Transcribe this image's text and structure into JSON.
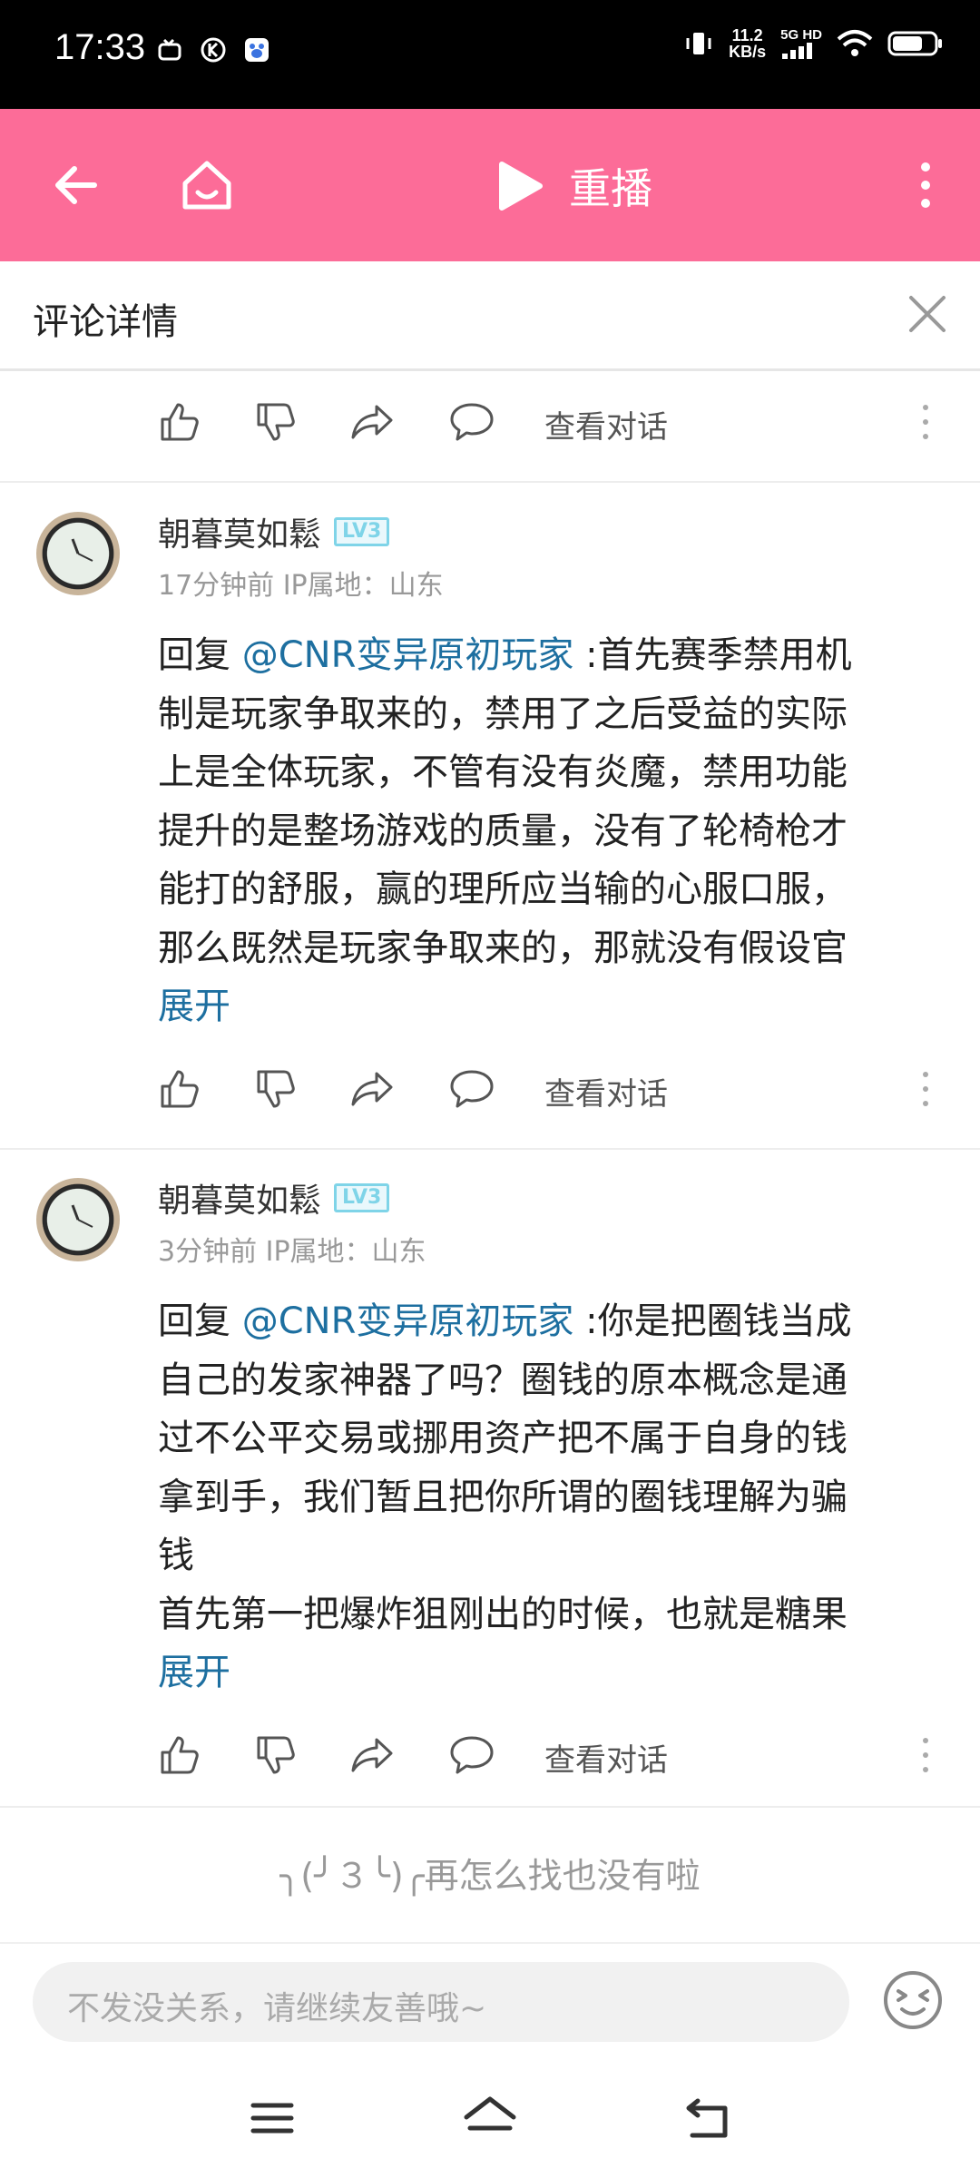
{
  "status_bar": {
    "time": "17:33",
    "speed_value": "11.2",
    "speed_unit": "KB/s",
    "network": "5G HD"
  },
  "app_bar": {
    "replay_label": "重播"
  },
  "detail": {
    "title": "评论详情"
  },
  "action_labels": {
    "view_conversation": "查看对话"
  },
  "comments": [
    {
      "username": "朝暮莫如鬆",
      "level": "LV3",
      "meta": "17分钟前 IP属地：山东",
      "reply_prefix": "回复 ",
      "mention": "@CNR变异原初玩家",
      "text_lines": [
        " :首先赛季禁用机",
        "制是玩家争取来的，禁用了之后受益的实际",
        "上是全体玩家，不管有没有炎魔，禁用功能",
        "提升的是整场游戏的质量，没有了轮椅枪才",
        "能打的舒服，赢的理所应当输的心服口服，",
        "那么既然是玩家争取来的，那就没有假设官"
      ],
      "expand": "展开"
    },
    {
      "username": "朝暮莫如鬆",
      "level": "LV3",
      "meta": "3分钟前 IP属地：山东",
      "reply_prefix": "回复 ",
      "mention": "@CNR变异原初玩家",
      "text_lines": [
        " :你是把圈钱当成",
        "自己的发家神器了吗？圈钱的原本概念是通",
        "过不公平交易或挪用资产把不属于自身的钱",
        "拿到手，我们暂且把你所谓的圈钱理解为骗",
        "钱",
        "首先第一把爆炸狙刚出的时候，也就是糖果"
      ],
      "expand": "展开"
    }
  ],
  "end_tip": "╮(╯３╰)╭再怎么找也没有啦",
  "comment_input": {
    "placeholder": "不发没关系，请继续友善哦~"
  },
  "colors": {
    "app_bar": "#fc6c98",
    "link": "#1d6fa0",
    "level_badge": "#7fd4e8"
  }
}
